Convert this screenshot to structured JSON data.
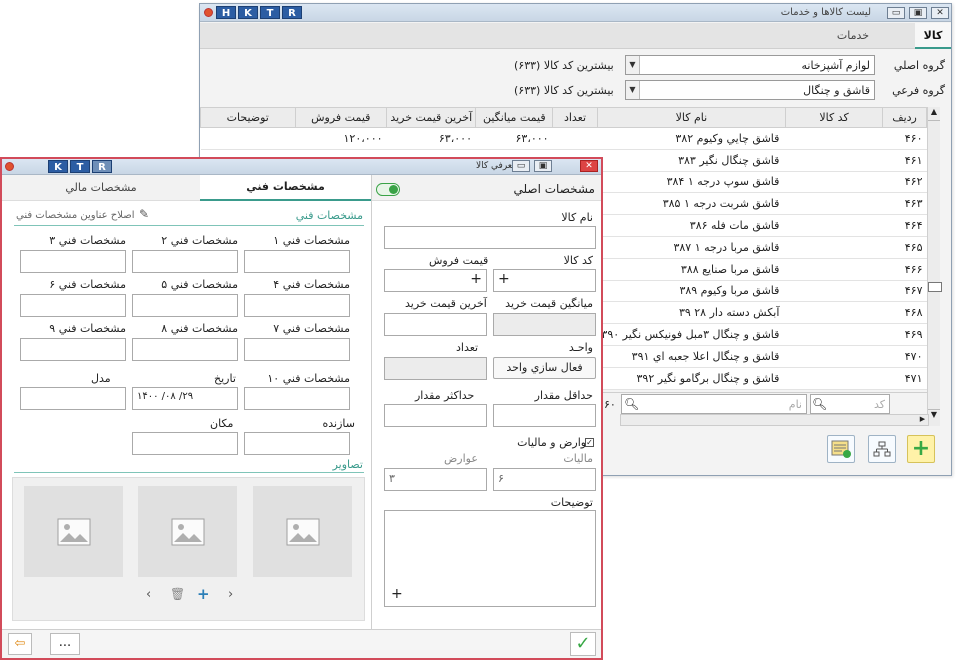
{
  "back_window": {
    "title": "ليست كالاها و خدمات",
    "tabs": [
      "کالا",
      "خدمات"
    ],
    "main_group": {
      "label": "گروه اصلي",
      "value": "لوازم آشپزخانه",
      "hint": "بیشترین کد کالا (۶۳۳)"
    },
    "sub_group": {
      "label": "گروه فرعي",
      "value": "قاشق و چنگال",
      "hint": "بیشترین کد کالا (۶۳۳)"
    },
    "columns": [
      "رديف",
      "کد کالا",
      "نام کالا",
      "تعداد",
      "قيمت ميانگين",
      "آخرين قيمت خريد",
      "قيمت فروش",
      "توضيحات"
    ],
    "rows": [
      [
        "۴۶۰",
        "",
        "۳۸۲ قاشق چايي وکيوم",
        "",
        "۶۳،۰۰۰",
        "۶۳،۰۰۰",
        "۱۲۰،۰۰۰"
      ],
      [
        "۴۶۱",
        "",
        "۳۸۳ قاشق چنگال نگير",
        "",
        "",
        "",
        ""
      ],
      [
        "۴۶۲",
        "",
        "۳۸۴ قاشق سوپ درجه ۱",
        "",
        "",
        "",
        ""
      ],
      [
        "۴۶۳",
        "",
        "۳۸۵ قاشق شربت درجه ۱",
        "",
        "",
        "",
        ""
      ],
      [
        "۴۶۴",
        "",
        "۳۸۶ قاشق مات فله",
        "",
        "",
        "",
        ""
      ],
      [
        "۴۶۵",
        "",
        "۳۸۷ قاشق مربا درجه ۱",
        "",
        "",
        "",
        ""
      ],
      [
        "۴۶۶",
        "",
        "۳۸۸ قاشق مربا صنايع",
        "",
        "",
        "",
        ""
      ],
      [
        "۴۶۷",
        "",
        "۳۸۹ قاشق مربا وکيوم",
        "",
        "",
        "",
        ""
      ],
      [
        "۴۶۸",
        "",
        "۳۹ آبکش دسته دار ۲۸",
        "",
        "",
        "",
        ""
      ],
      [
        "۴۶۹",
        "",
        "۳۹۰ قاشق و چنگال ۳مبل فونيکس نگير",
        "",
        "",
        "",
        ""
      ],
      [
        "۴۷۰",
        "",
        "۳۹۱ قاشق و چنگال اعلا جعبه اي",
        "",
        "",
        "",
        ""
      ],
      [
        "۴۷۱",
        "",
        "۳۹۲ قاشق و چنگال برگامو نگير",
        "",
        "",
        "",
        ""
      ]
    ],
    "footer": {
      "code_placeholder": "کد",
      "name_placeholder": "نام",
      "count": "۶۰"
    }
  },
  "front_window": {
    "title": "معرفي کالا",
    "tab_main": "مشخصات اصلي",
    "tab_tech": "مشخصات فني",
    "tab_fin": "مشخصات مالي",
    "tech_header": "مشخصات فني",
    "fix_titles": "اصلاح عناوين مشخصات فني",
    "item_name_label": "نام کالا",
    "code_label": "کد کالا",
    "sale_price_label": "قيمت فروش",
    "avg_price_label": "ميانگين قيمت خريد",
    "last_price_label": "آخرين قيمت خريد",
    "unit_label": "واحـد",
    "qty_label": "تعداد",
    "unit_button": "فعال سازي واحد",
    "min_label": "حداقل مقدار",
    "max_label": "حداکثر مقدار",
    "taxes_label": "عوارض و ماليات",
    "tax_label": "ماليات",
    "duty_label": "عوارض",
    "tax_value": "۶",
    "duty_value": "۳",
    "desc_label": "توضيحات",
    "plus": "+",
    "spec_labels": [
      "مشخصات فني ۱",
      "مشخصات فني ۲",
      "مشخصات فني ۳",
      "مشخصات فني ۴",
      "مشخصات فني ۵",
      "مشخصات فني ۶",
      "مشخصات فني ۷",
      "مشخصات فني ۸",
      "مشخصات فني ۹",
      "مشخصات فني ۱۰"
    ],
    "date_label": "تاريخ",
    "date_value": "۱۴۰۰ /۰۸ /۲۹",
    "model_label": "مدل",
    "maker_label": "سازنده",
    "place_label": "مکان",
    "images_label": "تصاوير",
    "more_label": "..."
  },
  "colors": {
    "accent": "#3a9b8c",
    "close": "#d24b5a",
    "ktr": "#2c5da3",
    "green": "#38a845"
  }
}
